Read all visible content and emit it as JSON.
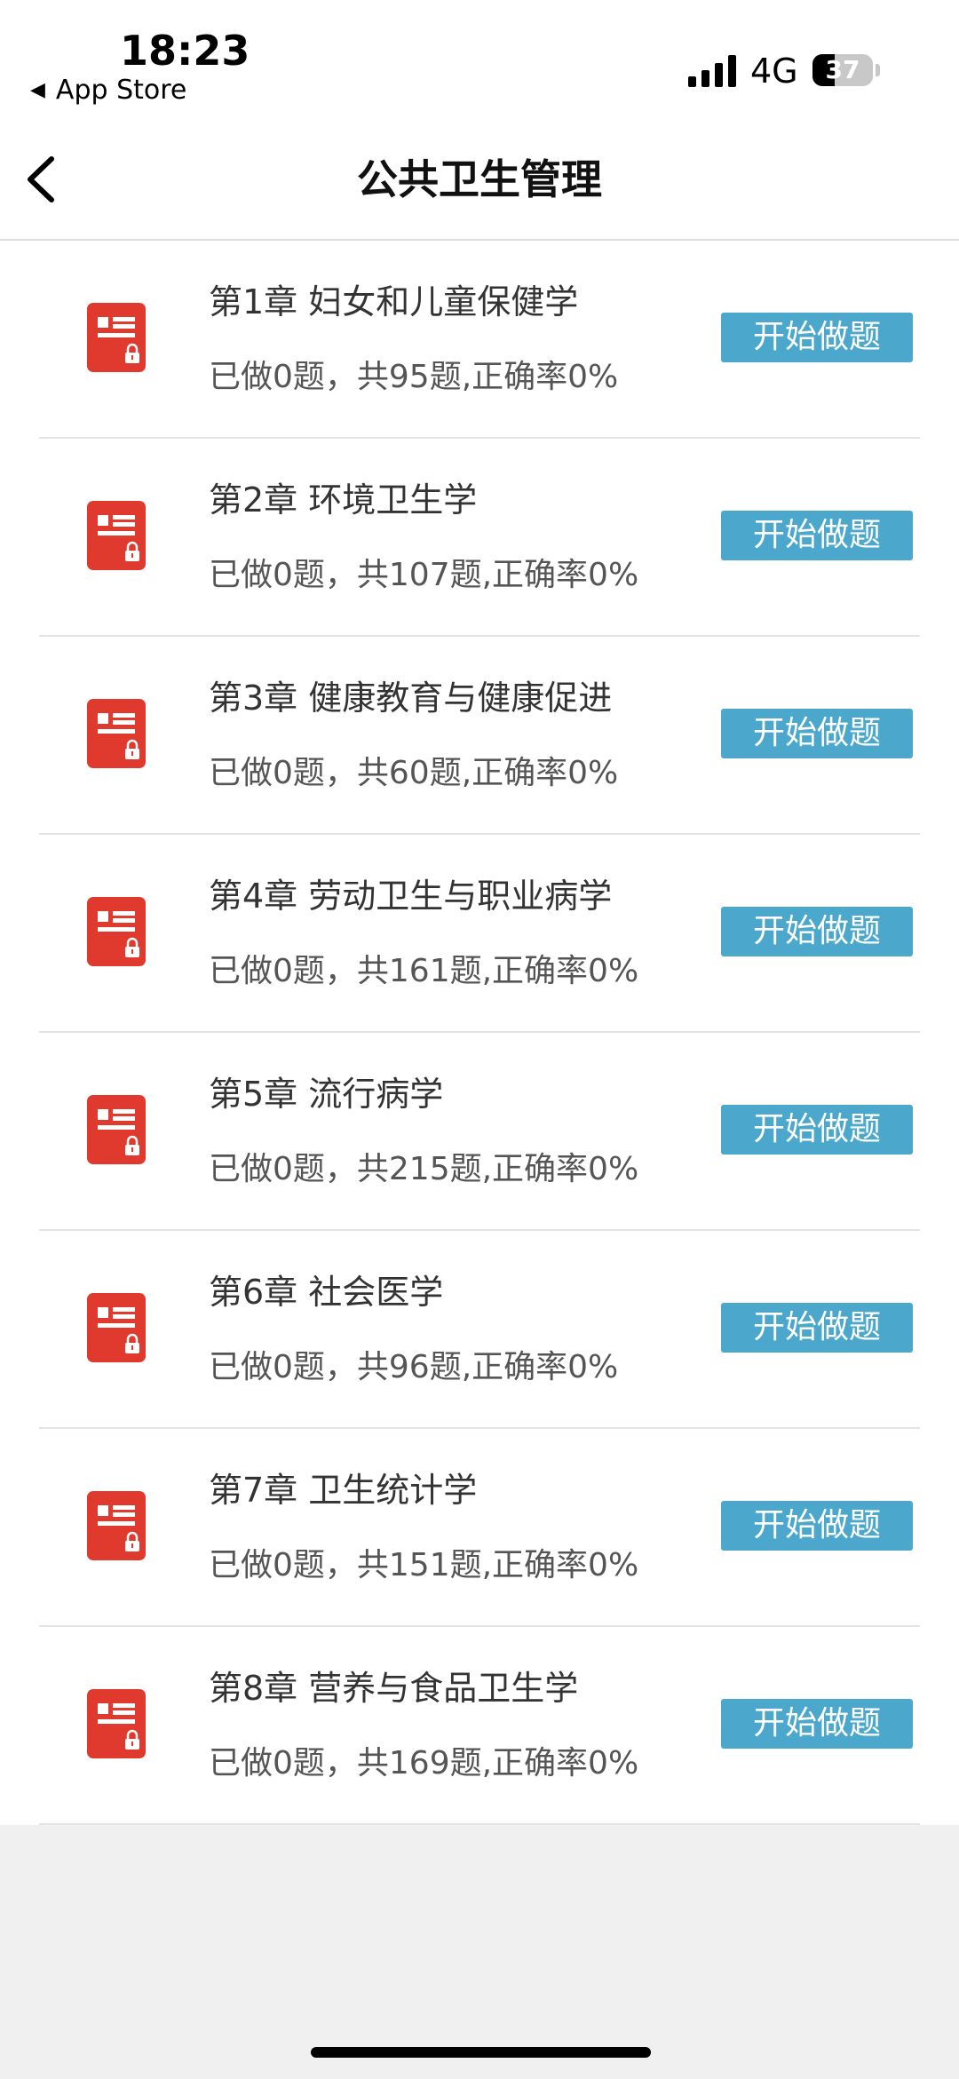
{
  "status_bar": {
    "time": "18:23",
    "back_app": "App Store",
    "network": "4G",
    "battery": "37",
    "battery_level": 0.37
  },
  "nav": {
    "title": "公共卫生管理",
    "back_icon": "chevron-left-icon"
  },
  "colors": {
    "accent": "#4ba8cc",
    "icon_red": "#e03a2e"
  },
  "chapters": [
    {
      "title": "第1章  妇女和儿童保健学",
      "progress": "已做0题，共95题,正确率0%",
      "button": "开始做题"
    },
    {
      "title": "第2章  环境卫生学",
      "progress": "已做0题，共107题,正确率0%",
      "button": "开始做题"
    },
    {
      "title": "第3章  健康教育与健康促进",
      "progress": "已做0题，共60题,正确率0%",
      "button": "开始做题"
    },
    {
      "title": "第4章  劳动卫生与职业病学",
      "progress": "已做0题，共161题,正确率0%",
      "button": "开始做题"
    },
    {
      "title": "第5章  流行病学",
      "progress": "已做0题，共215题,正确率0%",
      "button": "开始做题"
    },
    {
      "title": "第6章  社会医学",
      "progress": "已做0题，共96题,正确率0%",
      "button": "开始做题"
    },
    {
      "title": "第7章  卫生统计学",
      "progress": "已做0题，共151题,正确率0%",
      "button": "开始做题"
    },
    {
      "title": "第8章  营养与食品卫生学",
      "progress": "已做0题，共169题,正确率0%",
      "button": "开始做题"
    }
  ]
}
